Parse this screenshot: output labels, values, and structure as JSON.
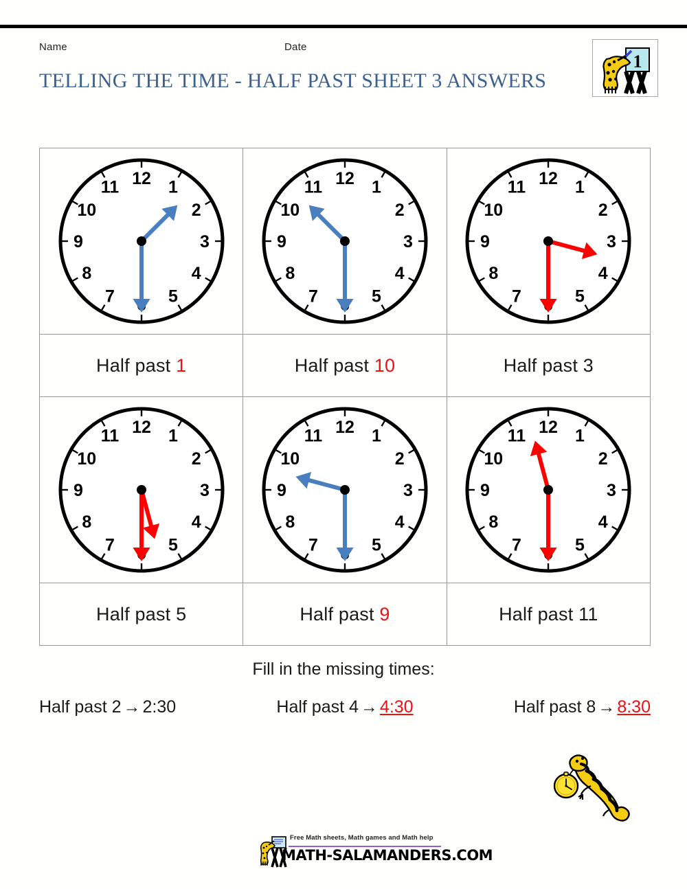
{
  "header": {
    "name_label": "Name",
    "date_label": "Date",
    "title": "TELLING THE TIME - HALF PAST SHEET 3 ANSWERS",
    "logo_number": "1",
    "title_color": "#3c6090"
  },
  "clocks": [
    {
      "id": "clock-1",
      "hand_color": "#4a7fbf",
      "hand_style": "blue",
      "hour": 1,
      "minute": 30,
      "hour_angle": 45,
      "minute_angle": 180,
      "label_prefix": "Half past ",
      "label_number": "1",
      "label_number_color": "#ee1111",
      "is_answer": true
    },
    {
      "id": "clock-2",
      "hand_color": "#4a7fbf",
      "hand_style": "blue",
      "hour": 10,
      "minute": 30,
      "hour_angle": 315,
      "minute_angle": 180,
      "label_prefix": "Half past ",
      "label_number": "10",
      "label_number_color": "#ee1111",
      "is_answer": true
    },
    {
      "id": "clock-3",
      "hand_color": "#ff0000",
      "hand_style": "red",
      "hour": 3,
      "minute": 30,
      "hour_angle": 105,
      "minute_angle": 180,
      "label_prefix": "Half past ",
      "label_number": "3",
      "label_number_color": "#1a1a1a",
      "is_answer": false
    },
    {
      "id": "clock-4",
      "hand_color": "#ff0000",
      "hand_style": "red",
      "hour": 5,
      "minute": 30,
      "hour_angle": 165,
      "minute_angle": 180,
      "label_prefix": "Half past ",
      "label_number": "5",
      "label_number_color": "#1a1a1a",
      "is_answer": false
    },
    {
      "id": "clock-5",
      "hand_color": "#4a7fbf",
      "hand_style": "blue",
      "hour": 9,
      "minute": 30,
      "hour_angle": 285,
      "minute_angle": 180,
      "label_prefix": "Half past ",
      "label_number": "9",
      "label_number_color": "#ee1111",
      "is_answer": true
    },
    {
      "id": "clock-6",
      "hand_color": "#ff0000",
      "hand_style": "red",
      "hour": 11,
      "minute": 30,
      "hour_angle": 345,
      "minute_angle": 180,
      "label_prefix": "Half past ",
      "label_number": "11",
      "label_number_color": "#1a1a1a",
      "is_answer": false
    }
  ],
  "clock_numerals": [
    "12",
    "1",
    "2",
    "3",
    "4",
    "5",
    "6",
    "7",
    "8",
    "9",
    "10",
    "11"
  ],
  "fill_section": {
    "title": "Fill in the missing times:",
    "items": [
      {
        "prompt": "Half past 2",
        "arrow": "→",
        "answer": "2:30",
        "answer_color": "#1a1a1a",
        "is_answer_filled": false
      },
      {
        "prompt": "Half past 4",
        "arrow": "→",
        "answer": "4:30",
        "answer_color": "#ee1111",
        "is_answer_filled": true
      },
      {
        "prompt": "Half past 8",
        "arrow": "→",
        "answer": "8:30",
        "answer_color": "#ee1111",
        "is_answer_filled": true
      }
    ]
  },
  "footer": {
    "tagline": "Free Math sheets, Math games and Math help",
    "url": "MATH-SALAMANDERS.COM",
    "rule_color": "#9b59c9"
  },
  "mascot": {
    "description": "salamander-holding-pocket-watch",
    "body_color": "#f5cc12",
    "watch_color": "#ffe234"
  }
}
